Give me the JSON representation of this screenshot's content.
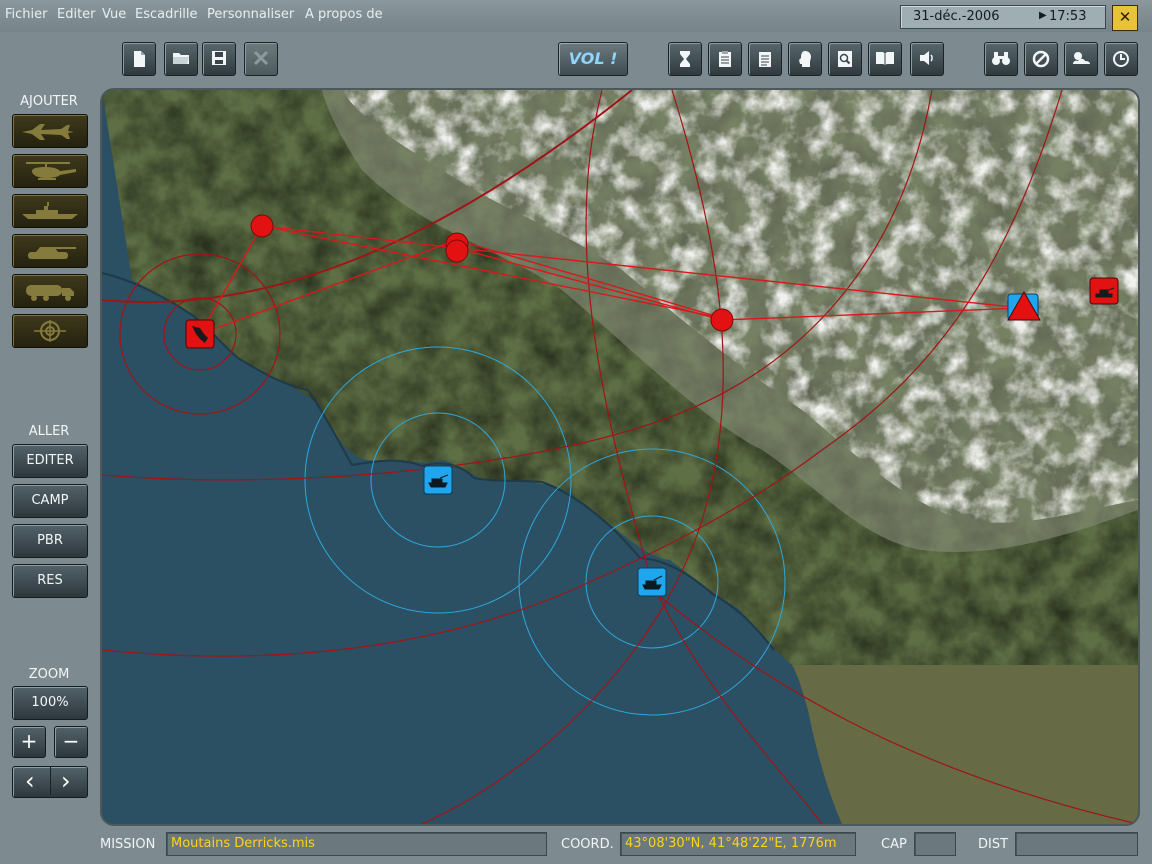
{
  "menu": [
    "Fichier",
    "Editer",
    "Vue",
    "Escadrille",
    "Personnaliser",
    "A propos de"
  ],
  "clock": {
    "date": "31-déc.-2006",
    "time": "17:53"
  },
  "close_glyph": "✕",
  "toolbar": {
    "vol_label": "VOL !",
    "file_icons": [
      "new-file-icon",
      "open-folder-icon",
      "save-icon",
      "delete-icon"
    ],
    "mid_icons": [
      "hourglass-icon",
      "clipboard-icon",
      "list-icon",
      "head-icon",
      "magnifier-icon",
      "book-icon",
      "speaker-icon"
    ],
    "right_icons": [
      "binoculars-icon",
      "no-entry-icon",
      "weather-icon",
      "clock-icon"
    ]
  },
  "left_panel": {
    "add_label": "AJOUTER",
    "add_icons": [
      "jet-icon",
      "helicopter-icon",
      "ship-icon",
      "tank-icon",
      "fuel-truck-icon",
      "target-icon"
    ],
    "goto_label": "ALLER",
    "goto_buttons": [
      "EDITER",
      "CAMP",
      "PBR",
      "RES"
    ],
    "zoom_label": "ZOOM",
    "zoom_value": "100%",
    "zoom_in": "+",
    "zoom_out": "−",
    "prev": "‹",
    "next": "›"
  },
  "status": {
    "mission_label": "MISSION",
    "mission_value": "Moutains Derricks.mis",
    "coord_label": "COORD.",
    "coord_value": "43°08'30\"N, 41°48'22\"E, 1776m",
    "cap_label": "CAP",
    "cap_value": "",
    "dist_label": "DIST",
    "dist_value": ""
  },
  "colors": {
    "red_coalition": "#e31212",
    "blue_coalition": "#1fa6ee",
    "sea": "#2b4f63",
    "route": "#c0181a",
    "volt_text": "#8fd6ff",
    "status_text": "#ffd21a"
  }
}
